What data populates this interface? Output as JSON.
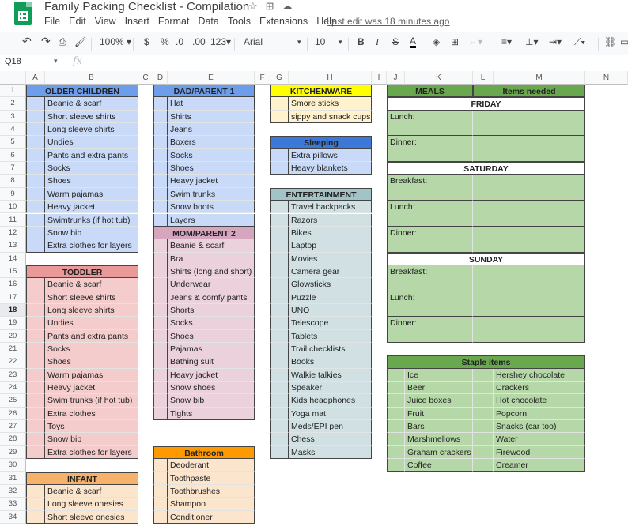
{
  "window": {
    "doc_title": "Family Packing Checklist - Compilation",
    "last_edit": "Last edit was 18 minutes ago",
    "menu": [
      "File",
      "Edit",
      "View",
      "Insert",
      "Format",
      "Data",
      "Tools",
      "Extensions",
      "Help"
    ]
  },
  "toolbar": {
    "zoom": "100%",
    "currency": "$",
    "percent": "%",
    "dec_decrease": ".0",
    "dec_increase": ".00",
    "format_more": "123",
    "font": "Arial",
    "font_size": "10",
    "bold": "B",
    "italic": "I",
    "strike": "S",
    "text_color": "A"
  },
  "formula_bar": {
    "name_box": "Q18",
    "fx_label": "fx"
  },
  "colors": {
    "blue_head": "#6d9eeb",
    "blue_body": "#c9daf8",
    "red_head": "#ea9999",
    "red_body": "#f4cccc",
    "orange_head": "#f6b26b",
    "orange_body": "#fce5cd",
    "bright_orange": "#ff9900",
    "pink_head": "#d5a6bd",
    "pink_body": "#ead1dc",
    "yellow_head": "#ffff00",
    "yellow_body": "#fff2cc",
    "sleep_head": "#3c78d8",
    "teal_head": "#a2c4c9",
    "teal_body": "#d0e0e3",
    "green_head": "#6aa84f",
    "green_body": "#b6d7a8"
  },
  "columns": [
    "A",
    "B",
    "C",
    "D",
    "E",
    "F",
    "G",
    "H",
    "I",
    "J",
    "K",
    "L",
    "M",
    "N"
  ],
  "rows": [
    "1",
    "2",
    "3",
    "4",
    "5",
    "6",
    "7",
    "8",
    "9",
    "10",
    "11",
    "12",
    "13",
    "14",
    "15",
    "16",
    "17",
    "18",
    "19",
    "20",
    "21",
    "22",
    "23",
    "24",
    "25",
    "26",
    "27",
    "28",
    "29",
    "30",
    "31",
    "32",
    "33",
    "34"
  ],
  "sheet": {
    "older_children": {
      "title": "OLDER CHILDREN",
      "items": [
        "Beanie & scarf",
        "Short sleeve shirts",
        "Long sleeve shirts",
        "Undies",
        "Pants and extra pants",
        "Socks",
        "Shoes",
        "Warm pajamas",
        "Heavy jacket",
        "Swimtrunks (if hot tub)",
        "Snow bib",
        "Extra clothes for layers"
      ]
    },
    "toddler": {
      "title": "TODDLER",
      "items": [
        "Beanie & scarf",
        "Short sleeve shirts",
        "Long sleeve shirts",
        "Undies",
        "Pants and extra pants",
        "Socks",
        "Shoes",
        "Warm pajamas",
        "Heavy jacket",
        "Swim trunks (if hot tub)",
        "Extra clothes",
        "Toys",
        "Snow bib",
        "Extra clothes for layers"
      ]
    },
    "infant": {
      "title": "INFANT",
      "items": [
        "Beanie & scarf",
        "Long sleeve onesies",
        "Short sleeve onesies"
      ]
    },
    "dad": {
      "title": "DAD/PARENT 1",
      "items": [
        "Hat",
        "Shirts",
        "Jeans",
        "Boxers",
        "Socks",
        "Shoes",
        "Heavy jacket",
        "Swim trunks",
        "Snow boots",
        "Layers"
      ]
    },
    "mom": {
      "title": "MOM/PARENT 2",
      "items": [
        "Beanie & scarf",
        "Bra",
        "Shirts (long and short)",
        "Underwear",
        "Jeans & comfy pants",
        "Shorts",
        "Socks",
        "Shoes",
        "Pajamas",
        "Bathing suit",
        "Heavy jacket",
        "Snow shoes",
        "Snow bib",
        "Tights"
      ]
    },
    "bathroom": {
      "title": "Bathroom",
      "items": [
        "Deoderant",
        "Toothpaste",
        "Toothbrushes",
        "Shampoo",
        "Conditioner"
      ]
    },
    "kitchenware": {
      "title": "KITCHENWARE",
      "items": [
        "Smore sticks",
        "sippy and snack cups"
      ]
    },
    "sleeping": {
      "title": "Sleeping",
      "items": [
        "Extra pillows",
        "Heavy blankets"
      ]
    },
    "entertainment": {
      "title": "ENTERTAINMENT",
      "items": [
        "Travel backpacks",
        "Razors",
        "Bikes",
        "Laptop",
        "Movies",
        "Camera gear",
        "Glowsticks",
        "Puzzle",
        "UNO",
        "Telescope",
        "Tablets",
        "Trail checklists",
        "Books",
        "Walkie talkies",
        "Speaker",
        "Kids headphones",
        "Yoga mat",
        "Meds/EPI pen",
        "Chess",
        "Masks"
      ]
    },
    "meals": {
      "title": "MEALS",
      "items_needed": "Items needed",
      "friday": "FRIDAY",
      "saturday": "SATURDAY",
      "sunday": "SUNDAY",
      "lunch": "Lunch:",
      "dinner": "Dinner:",
      "breakfast": "Breakfast:"
    },
    "staples": {
      "title": "Staple items",
      "left": [
        "Ice",
        "Beer",
        "Juice boxes",
        "Fruit",
        "Bars",
        "Marshmellows",
        "Graham crackers",
        "Coffee"
      ],
      "right": [
        "Hershey chocolate",
        "Crackers",
        "Hot chocolate",
        "Popcorn",
        "Snacks (car too)",
        "Water",
        "Firewood",
        "Creamer"
      ]
    }
  }
}
